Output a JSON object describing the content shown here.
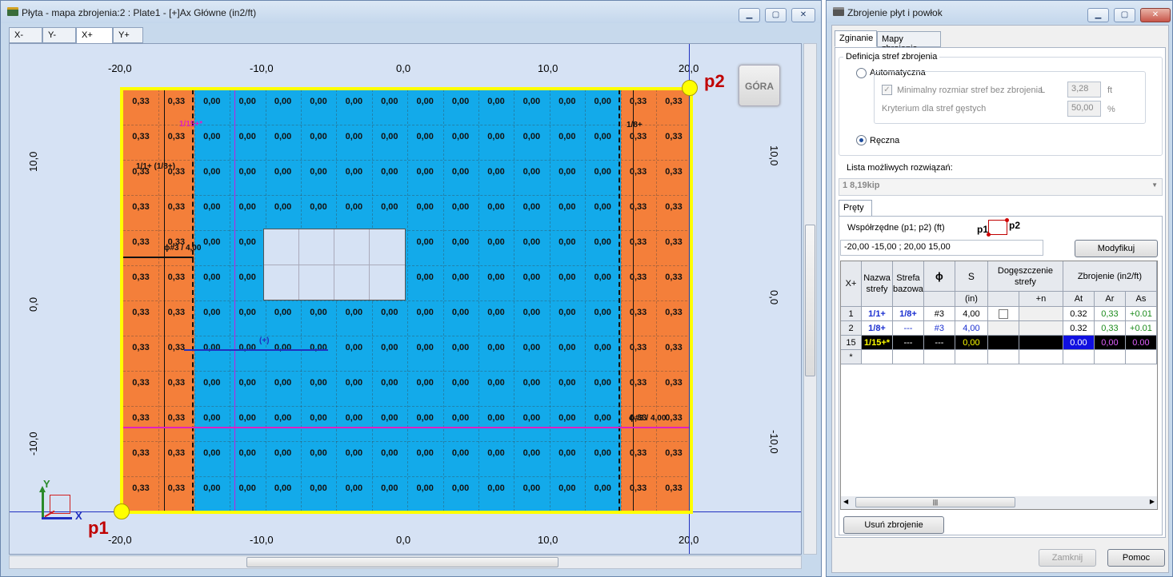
{
  "left_window": {
    "title": "Płyta - mapa zbrojenia:2 : Plate1 - [+]Ax Główne (in2/ft)",
    "view_tabs": [
      "X-",
      "Y-",
      "X+",
      "Y+"
    ],
    "active_view_tab": "X+",
    "x_axis_labels": [
      "-20,0",
      "-10,0",
      "0,0",
      "10,0",
      "20,0"
    ],
    "y_axis_labels": [
      "10,0",
      "0,0",
      "-10,0"
    ],
    "gora_button": "GÓRA",
    "point1": "p1",
    "point2": "p2",
    "axis_y": "Y",
    "axis_x": "X",
    "annotations": {
      "a1": "1/15+*",
      "a2": "1/8+",
      "a3": "1/1+ (1/8+)",
      "a4": "ϕ#3 / 4,00",
      "a5": "(+)",
      "a6": "ϕ#3 / 4,00"
    },
    "map": {
      "columns": 16,
      "rows": 12,
      "value_edge": "0,33",
      "value_mid": "0,00",
      "color_edge_zone": "#f47f3a",
      "color_mid_zone": "#13aaea",
      "color_border": "#ffff00"
    }
  },
  "right_window": {
    "title": "Zbrojenie płyt i powłok",
    "tabs": [
      "Zginanie",
      "Mapy zbrojenia"
    ],
    "active_tab": "Zginanie",
    "group_title": "Definicja stref zbrojenia",
    "radio_auto": "Automatyczna",
    "chk_min_label": "Minimalny rozmiar stref bez zbrojenia",
    "chk_min_sym": "L",
    "chk_min_value": "3,28",
    "chk_min_unit": "ft",
    "criterion_label": "Kryterium dla stref gęstych",
    "criterion_value": "50,00",
    "criterion_unit": "%",
    "radio_manual": "Ręczna",
    "solutions_label": "Lista możliwych rozwiązań:",
    "solution_selected": "1    8,19kip",
    "sub_tab": "Pręty",
    "coords_label": "Współrzędne (p1; p2) (ft)",
    "coords_p1": "p1",
    "coords_p2": "p2",
    "coords_value": "-20,00  -15,00  ;  20,00  15,00",
    "modify_button": "Modyfikuj",
    "table": {
      "corner": "X+",
      "h_name": "Nazwa strefy",
      "h_base": "Strefa bazowa",
      "h_phi": "ϕ",
      "h_s": "S",
      "h_s_unit": "(in)",
      "h_dens": "Dogęszczenie strefy",
      "h_dens_n": "+n",
      "h_reinf": "Zbrojenie (in2/ft)",
      "h_at": "At",
      "h_ar": "Ar",
      "h_as": "As",
      "rows": [
        {
          "id": "1",
          "name": "1/1+",
          "base": "1/8+",
          "phi": "#3",
          "s": "4,00",
          "at": "0.32",
          "ar": "0,33",
          "as": "+0.01"
        },
        {
          "id": "2",
          "name": "1/8+",
          "base": "---",
          "phi": "#3",
          "s": "4,00",
          "at": "0.32",
          "ar": "0,33",
          "as": "+0.01"
        },
        {
          "id": "15",
          "name": "1/15+*",
          "base": "---",
          "phi": "---",
          "s": "0,00",
          "at": "0.00",
          "ar": "0,00",
          "as": "0.00"
        }
      ],
      "new_row": "*"
    },
    "delete_button": "Usuń zbrojenie",
    "close_button": "Zamknij",
    "help_button": "Pomoc"
  }
}
